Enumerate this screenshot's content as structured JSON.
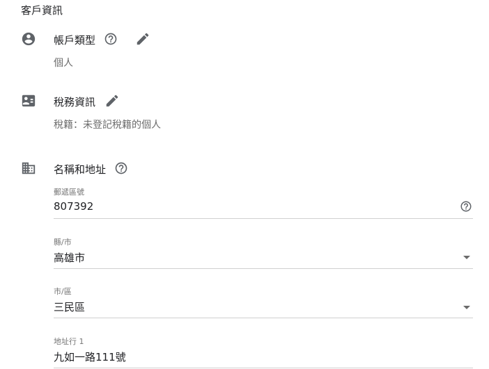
{
  "section": {
    "title": "客戶資訊"
  },
  "account_type": {
    "title": "帳戶類型",
    "value": "個人"
  },
  "tax_info": {
    "title": "稅務資訊",
    "value": "稅籍：未登記稅籍的個人"
  },
  "name_address": {
    "title": "名稱和地址",
    "fields": [
      {
        "label": "郵遞區號",
        "value": "807392",
        "trailing_icon": "help-icon"
      },
      {
        "label": "縣/市",
        "value": "高雄市",
        "trailing_icon": "dropdown-arrow-icon"
      },
      {
        "label": "市/區",
        "value": "三民區",
        "trailing_icon": "dropdown-arrow-icon"
      },
      {
        "label": "地址行 1",
        "value": "九如一路111號"
      }
    ]
  },
  "colors": {
    "icon": "#5f6368",
    "text": "#202124",
    "subtext": "#6b6b6b",
    "divider": "#d0d0d0"
  }
}
